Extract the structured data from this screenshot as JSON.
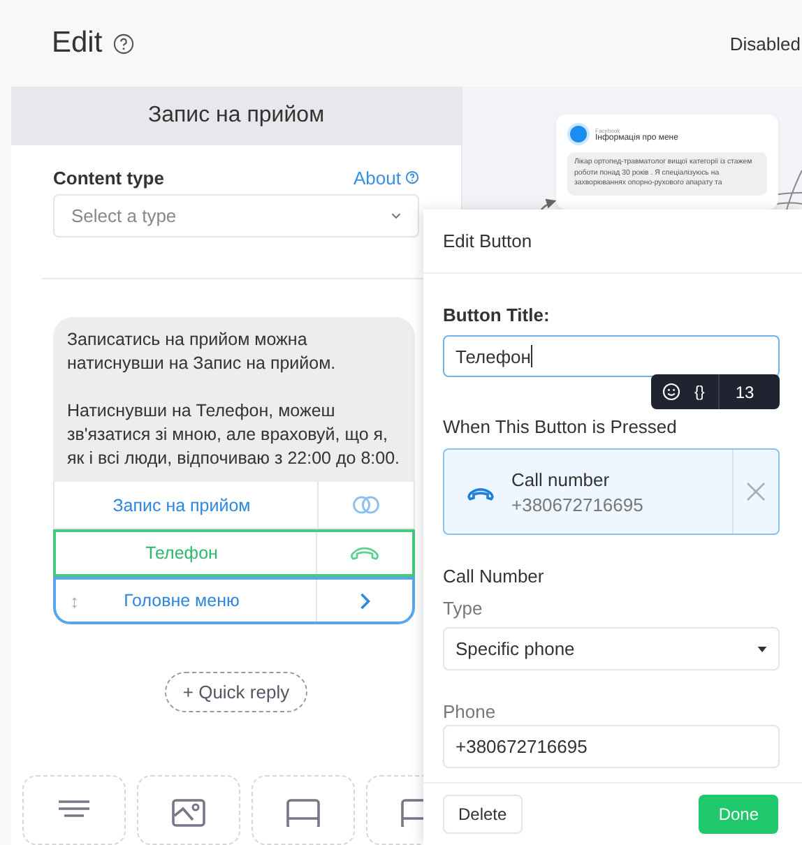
{
  "header": {
    "title": "Edit",
    "status": "Disabled"
  },
  "left_panel": {
    "title": "Запис на прийом",
    "content_type_label": "Content type",
    "about_link": "About",
    "type_select": {
      "placeholder": "Select a type"
    },
    "message": {
      "paragraphs": [
        "Записатись на прийом можна натиснувши на Запис на прийом.",
        "Натиснувши на Телефон, можеш зв'язатися зі мною, але враховуй, що я, як і всі люди, відпочиваю з 22:00 до 8:00."
      ]
    },
    "buttons": [
      {
        "label": "Запис на прийом",
        "kind": "link",
        "selected": false
      },
      {
        "label": "Телефон",
        "kind": "phone",
        "selected": true
      },
      {
        "label": "Головне меню",
        "kind": "next",
        "selected": false,
        "handle": "↕"
      }
    ],
    "quick_reply": "+ Quick reply",
    "block_tiles": [
      {
        "kind": "text"
      },
      {
        "kind": "image"
      },
      {
        "kind": "card"
      },
      {
        "kind": "card"
      }
    ]
  },
  "canvas": {
    "node": {
      "source": "Facebook",
      "title": "Інформація про мене",
      "text": "Лікар ортопед-травматолог вищої категорії із стажем роботи понад 30 років . Я спеціалізуюсь на захворюваннях опорно-рухового апарату та"
    }
  },
  "edit_button": {
    "title": "Edit Button",
    "button_title_label": "Button Title:",
    "button_title_value": "Телефон",
    "braces": "{}",
    "char_count": "13",
    "action_label": "When This Button is Pressed",
    "action": {
      "kind": "phone",
      "title": "Call number",
      "value": "+380672716695"
    },
    "section_title": "Call Number",
    "type_label": "Type",
    "type_value": "Specific phone",
    "phone_label": "Phone",
    "phone_value": "+380672716695",
    "delete": "Delete",
    "done": "Done"
  }
}
